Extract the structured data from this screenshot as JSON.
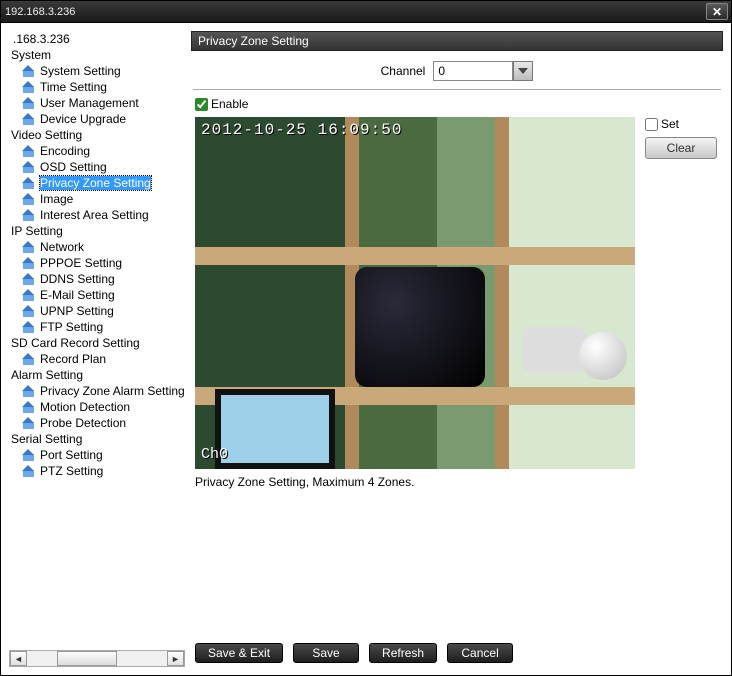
{
  "window": {
    "title": "192.168.3.236"
  },
  "tree": {
    "root": ".168.3.236",
    "groups": [
      {
        "label": "System",
        "items": [
          "System Setting",
          "Time Setting",
          "User Management",
          "Device Upgrade"
        ]
      },
      {
        "label": "Video Setting",
        "items": [
          "Encoding",
          "OSD Setting",
          "Privacy Zone Setting",
          "Image",
          "Interest Area Setting"
        ]
      },
      {
        "label": "IP Setting",
        "items": [
          "Network",
          "PPPOE Setting",
          "DDNS Setting",
          "E-Mail Setting",
          "UPNP Setting",
          "FTP Setting"
        ]
      },
      {
        "label": "SD Card Record Setting",
        "items": [
          "Record Plan"
        ]
      },
      {
        "label": "Alarm Setting",
        "items": [
          "Privacy Zone Alarm Setting",
          "Motion Detection",
          "Probe Detection"
        ]
      },
      {
        "label": "Serial Setting",
        "items": [
          "Port Setting",
          "PTZ Setting"
        ]
      }
    ],
    "selected": "Privacy Zone Setting"
  },
  "panel": {
    "title": "Privacy Zone Setting",
    "channel_label": "Channel",
    "channel_value": "0",
    "enable_label": "Enable",
    "enable_checked": true,
    "set_label": "Set",
    "set_checked": false,
    "clear_label": "Clear",
    "hint": "Privacy Zone Setting, Maximum 4 Zones."
  },
  "preview": {
    "timestamp": "2012-10-25 16:09:50",
    "channel_overlay": "Ch0"
  },
  "footer": {
    "save_exit": "Save & Exit",
    "save": "Save",
    "refresh": "Refresh",
    "cancel": "Cancel"
  }
}
